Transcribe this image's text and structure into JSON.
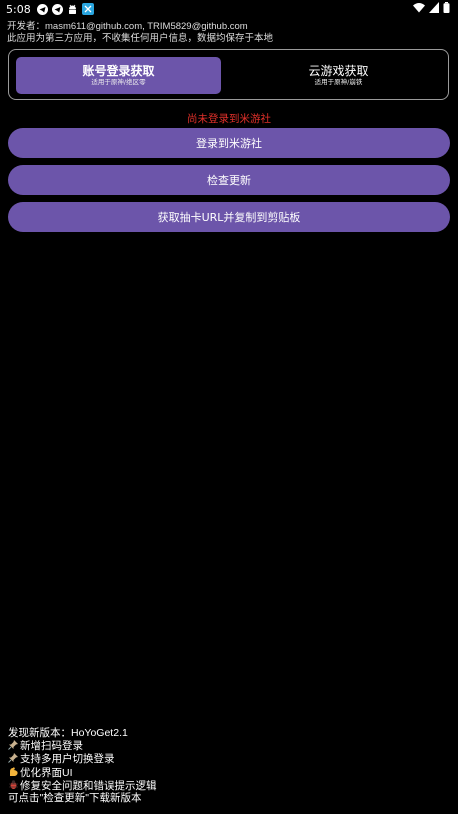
{
  "status_bar": {
    "time": "5:08",
    "colors": {
      "telegram": "#ffffff",
      "app": "#2aa6e0"
    }
  },
  "header": {
    "developer_line": "开发者：masm611@github.com, TRIM5829@github.com",
    "privacy_line": "此应用为第三方应用，不收集任何用户信息，数据均保存于本地"
  },
  "tabs": [
    {
      "title": "账号登录获取",
      "subtitle": "适用于原神/绝区零",
      "active": true
    },
    {
      "title": "云游戏获取",
      "subtitle": "适用于原神/崩铁",
      "active": false
    }
  ],
  "login_status": "尚未登录到米游社",
  "buttons": {
    "login": "登录到米游社",
    "check_update": "检查更新",
    "fetch_url": "获取抽卡URL并复制到剪贴板"
  },
  "notes": {
    "version": "发现新版本：HoYoGet2.1",
    "items": [
      {
        "icon": "pin-icon",
        "text": "新增扫码登录"
      },
      {
        "icon": "pin-icon",
        "text": "支持多用户切换登录"
      },
      {
        "icon": "muscle-icon",
        "text": "优化界面UI"
      },
      {
        "icon": "bug-icon",
        "text": "修复安全问题和错误提示逻辑"
      }
    ],
    "footer": "可点击\"检查更新\"下载新版本"
  },
  "colors": {
    "accent": "#6c55aa",
    "error": "#e0302a",
    "background": "#000000"
  }
}
